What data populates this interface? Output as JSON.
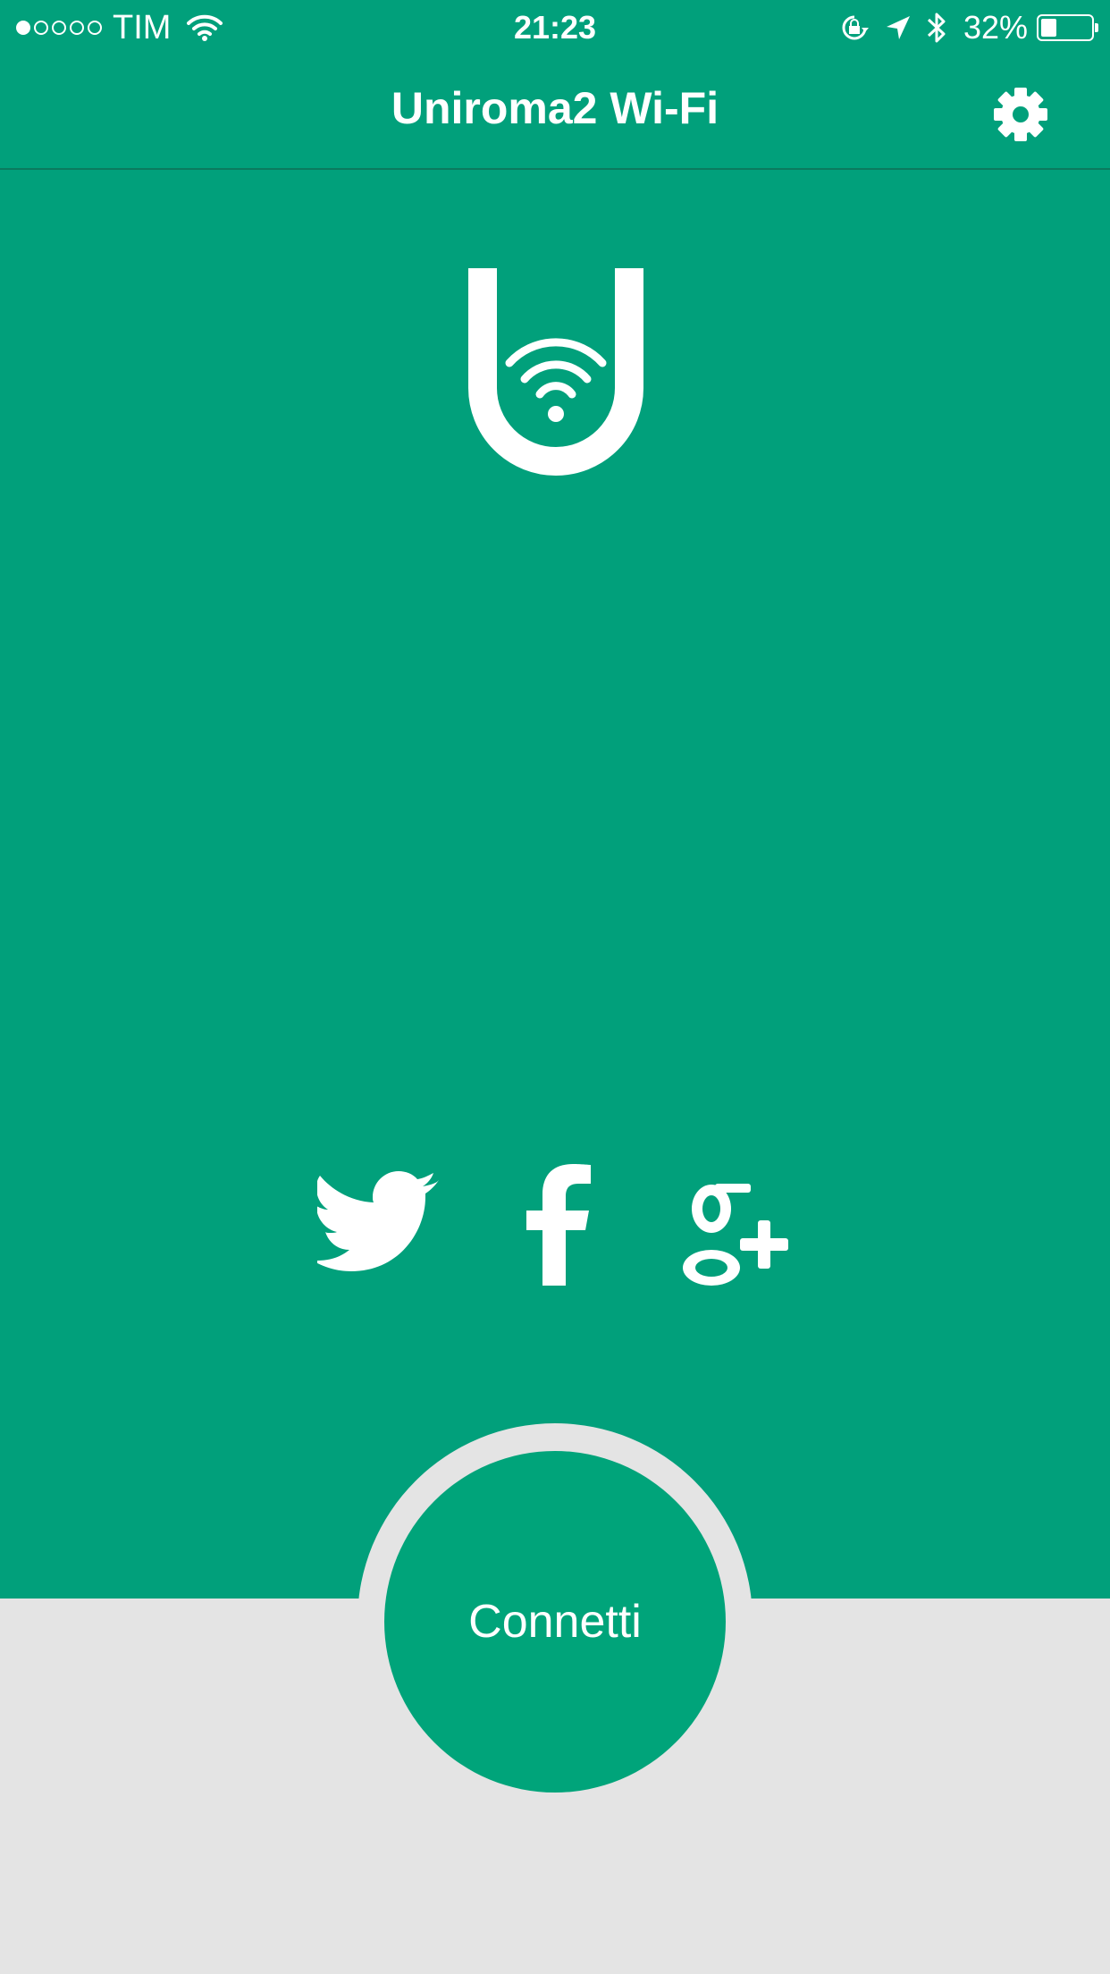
{
  "status_bar": {
    "carrier": "TIM",
    "time": "21:23",
    "battery_percent": "32%",
    "battery_level": 0.32,
    "signal_dots_filled": 1,
    "signal_dots_total": 5
  },
  "nav": {
    "title": "Uniroma2 Wi-Fi",
    "settings_icon": "gear-icon"
  },
  "logo": {
    "icon": "uniroma2-wifi-logo"
  },
  "social": [
    {
      "icon": "twitter-icon"
    },
    {
      "icon": "facebook-icon"
    },
    {
      "icon": "google-plus-icon"
    }
  ],
  "connect": {
    "label": "Connetti"
  },
  "colors": {
    "primary": "#01a07b",
    "button": "#00a47a",
    "background": "#e4e4e4",
    "text": "#ffffff"
  }
}
